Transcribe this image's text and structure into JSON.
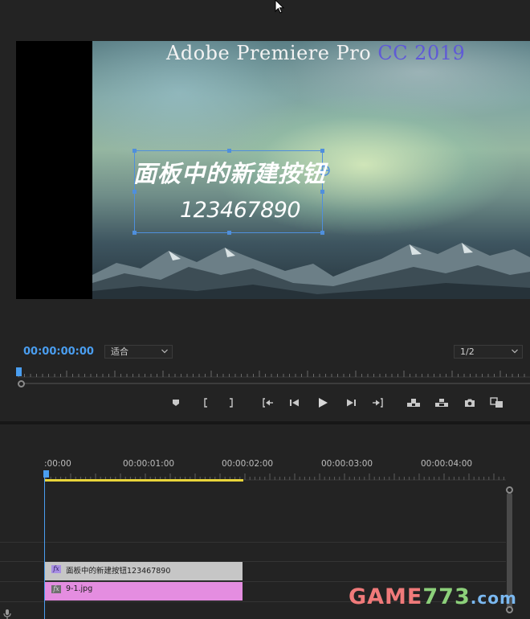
{
  "monitor": {
    "overlay_title": "Adobe Premiere Pro",
    "overlay_version": "CC 2019",
    "text_layer": {
      "line1": "面板中的新建按钮",
      "line2": "123467890"
    },
    "timecode": "00:00:00:00",
    "fit_select": {
      "value": "适合"
    },
    "resolution_select": {
      "value": "1/2"
    },
    "controls": [
      {
        "name": "add-marker",
        "icon": "marker-icon"
      },
      {
        "name": "mark-in",
        "icon": "mark-in-icon"
      },
      {
        "name": "mark-out",
        "icon": "mark-out-icon"
      },
      {
        "name": "go-to-in",
        "icon": "go-to-in-icon"
      },
      {
        "name": "step-back",
        "icon": "step-back-icon"
      },
      {
        "name": "play",
        "icon": "play-icon"
      },
      {
        "name": "step-forward",
        "icon": "step-forward-icon"
      },
      {
        "name": "go-to-out",
        "icon": "go-to-out-icon"
      },
      {
        "name": "lift",
        "icon": "lift-icon"
      },
      {
        "name": "extract",
        "icon": "extract-icon"
      },
      {
        "name": "export-frame",
        "icon": "camera-icon"
      },
      {
        "name": "comparison-view",
        "icon": "comparison-icon"
      }
    ]
  },
  "timeline": {
    "ruler_labels": [
      ":00:00",
      "00:00:01:00",
      "00:00:02:00",
      "00:00:03:00",
      "00:00:04:00"
    ],
    "clips": {
      "title_clip": {
        "label": "面板中的新建按钮123467890",
        "fx": "fx",
        "color": "#c6c6c6"
      },
      "image_clip": {
        "label": "9-1.jpg",
        "fx": "fx",
        "color": "#e48de0"
      }
    },
    "playhead_color": "#4a9ef0",
    "work_area_color": "#e8d43a"
  },
  "watermark": {
    "part1": "GAME",
    "part2": "773",
    "part3": ".com"
  }
}
